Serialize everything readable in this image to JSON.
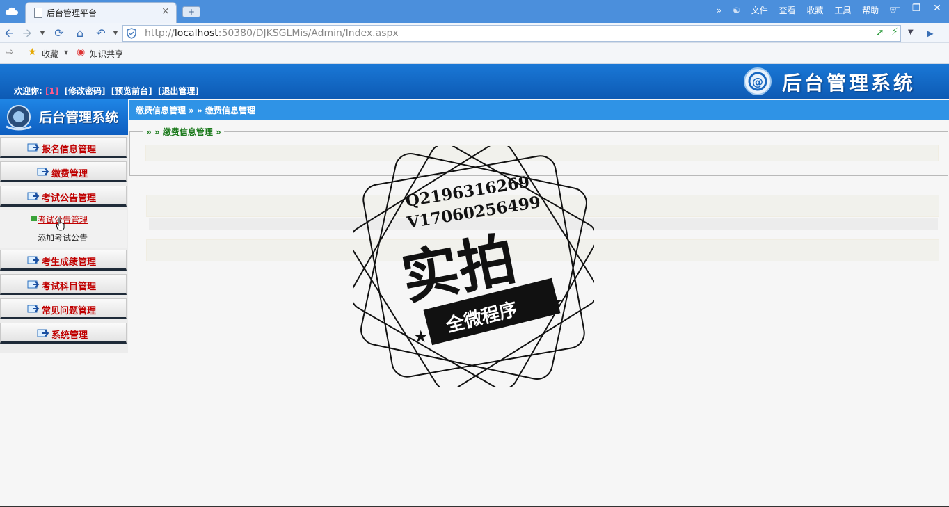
{
  "browser": {
    "tab_title": "后台管理平台",
    "tab_close": "×",
    "new_tab": "+",
    "menu": [
      "»",
      "文件",
      "查看",
      "收藏",
      "工具",
      "帮助"
    ],
    "window_buttons": [
      "─",
      "❐",
      "✕"
    ],
    "url_prefix": "http://",
    "url_host": "localhost",
    "url_rest": ":50380/DJKSGLMis/Admin/Index.aspx",
    "favorites_label": "收藏",
    "knowledge_share_label": "知识共享"
  },
  "header": {
    "welcome_label": "欢迎你:",
    "username": "[1]",
    "change_password": "[修改密码]",
    "preview_front": "[预览前台]",
    "logout": "[退出管理]",
    "title": "后台管理系统"
  },
  "sidebar": {
    "logo_text": "后台管理系统",
    "items": [
      {
        "label": "报名信息管理"
      },
      {
        "label": "缴费管理"
      },
      {
        "label": "考试公告管理"
      },
      {
        "label": "考生成绩管理"
      },
      {
        "label": "考试科目管理"
      },
      {
        "label": "常见问题管理"
      },
      {
        "label": "系统管理"
      }
    ],
    "sub_items": [
      {
        "label": "考试公告管理"
      },
      {
        "label": "添加考试公告"
      }
    ]
  },
  "content": {
    "breadcrumb": "缴费信息管理 » » 缴费信息管理",
    "legend": "» » 缴费信息管理 »"
  },
  "watermark": {
    "line1": "Q2196316269",
    "line2": "V17060256499",
    "big": "实拍",
    "ribbon": "全微程序"
  },
  "colors": {
    "header_blue": "#0d5ab4",
    "menu_red": "#c00000",
    "legend_green": "#1c7a1c"
  }
}
